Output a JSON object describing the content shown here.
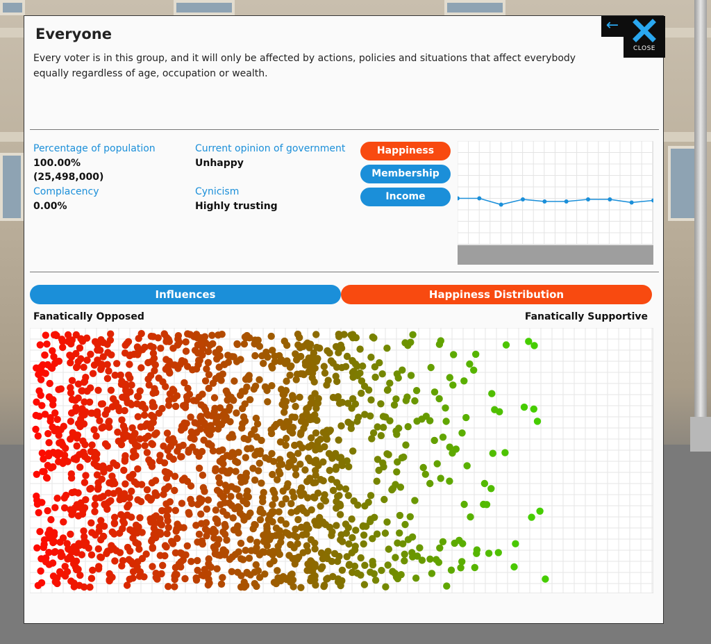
{
  "panel": {
    "title": "Everyone",
    "description": "Every voter is in this group, and it will only be affected by actions, policies and situations that affect everybody equally regardless of age, occupation or wealth.",
    "close_label": "CLOSE",
    "back_icon": "arrow-left-icon",
    "close_icon": "x-icon"
  },
  "stats": {
    "population_label": "Percentage of population",
    "population_pct": "100.00%",
    "population_count": "(25,498,000)",
    "complacency_label": "Complacency",
    "complacency_value": "0.00%",
    "opinion_label": "Current opinion of government",
    "opinion_value": "Unhappy",
    "cynicism_label": "Cynicism",
    "cynicism_value": "Highly trusting"
  },
  "chart_buttons": [
    {
      "label": "Happiness",
      "active": true
    },
    {
      "label": "Membership",
      "active": false
    },
    {
      "label": "Income",
      "active": false
    }
  ],
  "colors": {
    "accent_blue": "#1b8fd9",
    "accent_orange": "#f84a10",
    "opposed": "#ff0000",
    "supportive": "#44cc00"
  },
  "tabs": {
    "influences": "Influences",
    "distribution": "Happiness Distribution",
    "active": "distribution"
  },
  "distribution": {
    "left_label": "Fanatically Opposed",
    "right_label": "Fanatically Supportive"
  },
  "chart_data": [
    {
      "type": "line",
      "series": [
        {
          "values": [
            0.45,
            0.45,
            0.39,
            0.44,
            0.42,
            0.42,
            0.44,
            0.44,
            0.41,
            0.43
          ]
        }
      ],
      "ylim": [
        0,
        1
      ],
      "grid": true
    },
    {
      "type": "scatter",
      "xlim": [
        0,
        1
      ],
      "grid": true,
      "bands": [
        {
          "range": [
            0.0,
            0.1
          ],
          "count": 280
        },
        {
          "range": [
            0.1,
            0.2
          ],
          "count": 300
        },
        {
          "range": [
            0.2,
            0.3
          ],
          "count": 280
        },
        {
          "range": [
            0.3,
            0.38
          ],
          "count": 220
        },
        {
          "range": [
            0.38,
            0.46
          ],
          "count": 260
        },
        {
          "range": [
            0.46,
            0.52
          ],
          "count": 140
        },
        {
          "range": [
            0.52,
            0.58
          ],
          "count": 80
        },
        {
          "range": [
            0.58,
            0.64
          ],
          "count": 55
        },
        {
          "range": [
            0.64,
            0.7
          ],
          "count": 35
        },
        {
          "range": [
            0.7,
            0.76
          ],
          "count": 20
        },
        {
          "range": [
            0.76,
            0.84
          ],
          "count": 12
        }
      ]
    }
  ]
}
